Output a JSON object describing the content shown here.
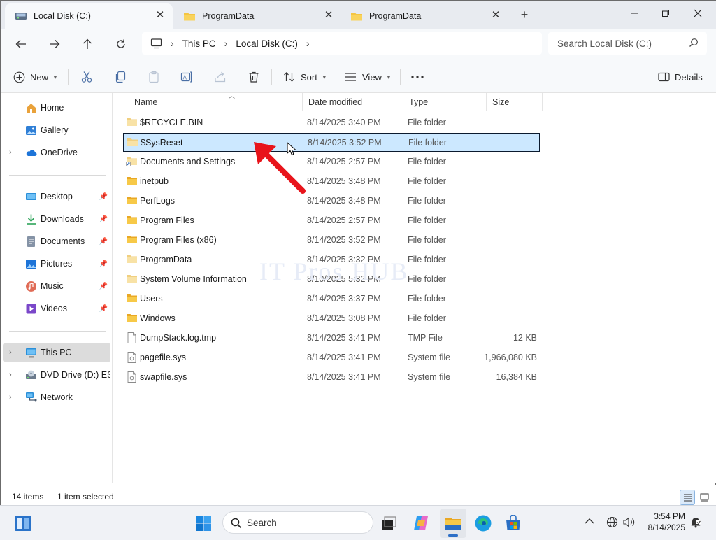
{
  "window": {
    "tabs": [
      {
        "title": "Local Disk (C:)",
        "icon": "drive-icon",
        "active": true
      },
      {
        "title": "ProgramData",
        "icon": "folder-icon",
        "active": false
      },
      {
        "title": "ProgramData",
        "icon": "folder-icon",
        "active": false
      }
    ],
    "controls": [
      "minimize",
      "maximize",
      "close"
    ]
  },
  "address": {
    "segments": [
      "This PC",
      "Local Disk (C:)"
    ],
    "search_placeholder": "Search Local Disk (C:)"
  },
  "toolbar": {
    "new_label": "New",
    "sort_label": "Sort",
    "view_label": "View",
    "details_label": "Details",
    "icons": [
      "cut-icon",
      "copy-icon",
      "paste-icon",
      "rename-icon",
      "share-icon",
      "delete-icon",
      "more-icon"
    ]
  },
  "sidebar": {
    "items": [
      {
        "label": "Home",
        "icon": "home-icon"
      },
      {
        "label": "Gallery",
        "icon": "gallery-icon"
      },
      {
        "label": "OneDrive",
        "icon": "onedrive-icon"
      },
      {
        "label": "Desktop",
        "icon": "desktop-icon",
        "pinned": true
      },
      {
        "label": "Downloads",
        "icon": "downloads-icon",
        "pinned": true
      },
      {
        "label": "Documents",
        "icon": "documents-icon",
        "pinned": true
      },
      {
        "label": "Pictures",
        "icon": "pictures-icon",
        "pinned": true
      },
      {
        "label": "Music",
        "icon": "music-icon",
        "pinned": true
      },
      {
        "label": "Videos",
        "icon": "videos-icon",
        "pinned": true
      },
      {
        "label": "This PC",
        "icon": "this-pc-icon",
        "selected": true
      },
      {
        "label": "DVD Drive (D:) ESD-",
        "icon": "dvd-drive-icon"
      },
      {
        "label": "Network",
        "icon": "network-icon"
      }
    ]
  },
  "columns": {
    "name": "Name",
    "date": "Date modified",
    "type": "Type",
    "size": "Size"
  },
  "files": [
    {
      "name": "$RECYCLE.BIN",
      "date": "8/14/2025 3:40 PM",
      "type": "File folder",
      "size": "",
      "kind": "folder-faded"
    },
    {
      "name": "$SysReset",
      "date": "8/14/2025 3:52 PM",
      "type": "File folder",
      "size": "",
      "kind": "folder-faded",
      "selected": true
    },
    {
      "name": "Documents and Settings",
      "date": "8/14/2025 2:57 PM",
      "type": "File folder",
      "size": "",
      "kind": "folder-link"
    },
    {
      "name": "inetpub",
      "date": "8/14/2025 3:48 PM",
      "type": "File folder",
      "size": "",
      "kind": "folder"
    },
    {
      "name": "PerfLogs",
      "date": "8/14/2025 3:48 PM",
      "type": "File folder",
      "size": "",
      "kind": "folder"
    },
    {
      "name": "Program Files",
      "date": "8/14/2025 2:57 PM",
      "type": "File folder",
      "size": "",
      "kind": "folder"
    },
    {
      "name": "Program Files (x86)",
      "date": "8/14/2025 3:52 PM",
      "type": "File folder",
      "size": "",
      "kind": "folder"
    },
    {
      "name": "ProgramData",
      "date": "8/14/2025 3:32 PM",
      "type": "File folder",
      "size": "",
      "kind": "folder-faded"
    },
    {
      "name": "System Volume Information",
      "date": "8/10/2025 5:32 PM",
      "type": "File folder",
      "size": "",
      "kind": "folder-faded"
    },
    {
      "name": "Users",
      "date": "8/14/2025 3:37 PM",
      "type": "File folder",
      "size": "",
      "kind": "folder"
    },
    {
      "name": "Windows",
      "date": "8/14/2025 3:08 PM",
      "type": "File folder",
      "size": "",
      "kind": "folder"
    },
    {
      "name": "DumpStack.log.tmp",
      "date": "8/14/2025 3:41 PM",
      "type": "TMP File",
      "size": "12 KB",
      "kind": "file"
    },
    {
      "name": "pagefile.sys",
      "date": "8/14/2025 3:41 PM",
      "type": "System file",
      "size": "1,966,080 KB",
      "kind": "sysfile"
    },
    {
      "name": "swapfile.sys",
      "date": "8/14/2025 3:41 PM",
      "type": "System file",
      "size": "16,384 KB",
      "kind": "sysfile"
    }
  ],
  "watermark": "IT Pros HUB",
  "status": {
    "item_count": "14 items",
    "selection": "1 item selected"
  },
  "taskbar": {
    "search_placeholder": "Search",
    "time": "3:54 PM",
    "date": "8/14/2025"
  },
  "colors": {
    "accent": "#0067c0",
    "selection": "#cce8ff",
    "folder": "#f4c542",
    "arrow": "#e8141b"
  }
}
